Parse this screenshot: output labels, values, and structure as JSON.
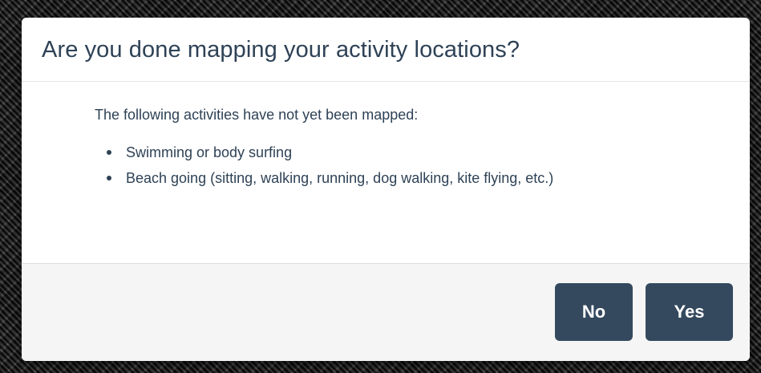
{
  "dialog": {
    "title": "Are you done mapping your activity locations?",
    "intro": "The following activities have not yet been mapped:",
    "unmapped_activities": [
      "Swimming or body surfing",
      "Beach going (sitting, walking, running, dog walking, kite flying, etc.)"
    ],
    "buttons": {
      "no_label": "No",
      "yes_label": "Yes"
    }
  },
  "colors": {
    "title_text": "#2e4256",
    "button_bg": "#34495e",
    "button_text": "#ffffff",
    "footer_bg": "#f5f5f5"
  }
}
